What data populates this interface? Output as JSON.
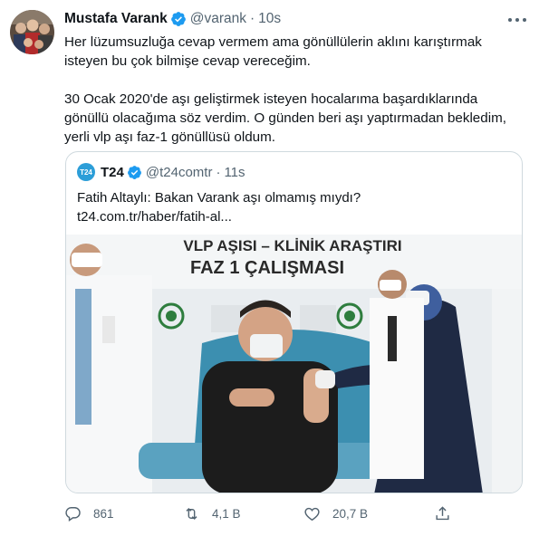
{
  "tweet": {
    "author_name": "Mustafa Varank",
    "handle": "@varank",
    "separator": "·",
    "time": "10s",
    "lines": [
      "Her lüzumsuzluğa cevap vermem ama gönüllülerin aklını karıştırmak",
      "isteyen bu çok bilmişe cevap vereceğim.",
      "30 Ocak 2020'de aşı geliştirmek isteyen hocalarıma başardıklarında",
      "gönüllü olacağıma söz verdim. O günden beri aşı yaptırmadan bekledim,",
      "yerli vlp aşı faz-1 gönüllüsü oldum."
    ]
  },
  "quoted": {
    "avatar_text": "T24",
    "author_name": "T24",
    "handle": "@t24comtr",
    "separator": "·",
    "time": "11s",
    "line1": "Fatih Altaylı: Bakan Varank aşı olmamış mıydı?",
    "line2": "t24.com.tr/haber/fatih-al...",
    "photo": {
      "banner_line1": "VLP AŞISI – KLİNİK ARAŞTIRI",
      "banner_line2": "FAZ 1 ÇALIŞMASI"
    }
  },
  "actions": {
    "reply_count": "861",
    "retweet_count": "4,1 B",
    "like_count": "20,7 B"
  },
  "colors": {
    "text": "#0f1419",
    "secondary": "#536471",
    "verified": "#1d9bf0",
    "border": "#cfd9de"
  }
}
